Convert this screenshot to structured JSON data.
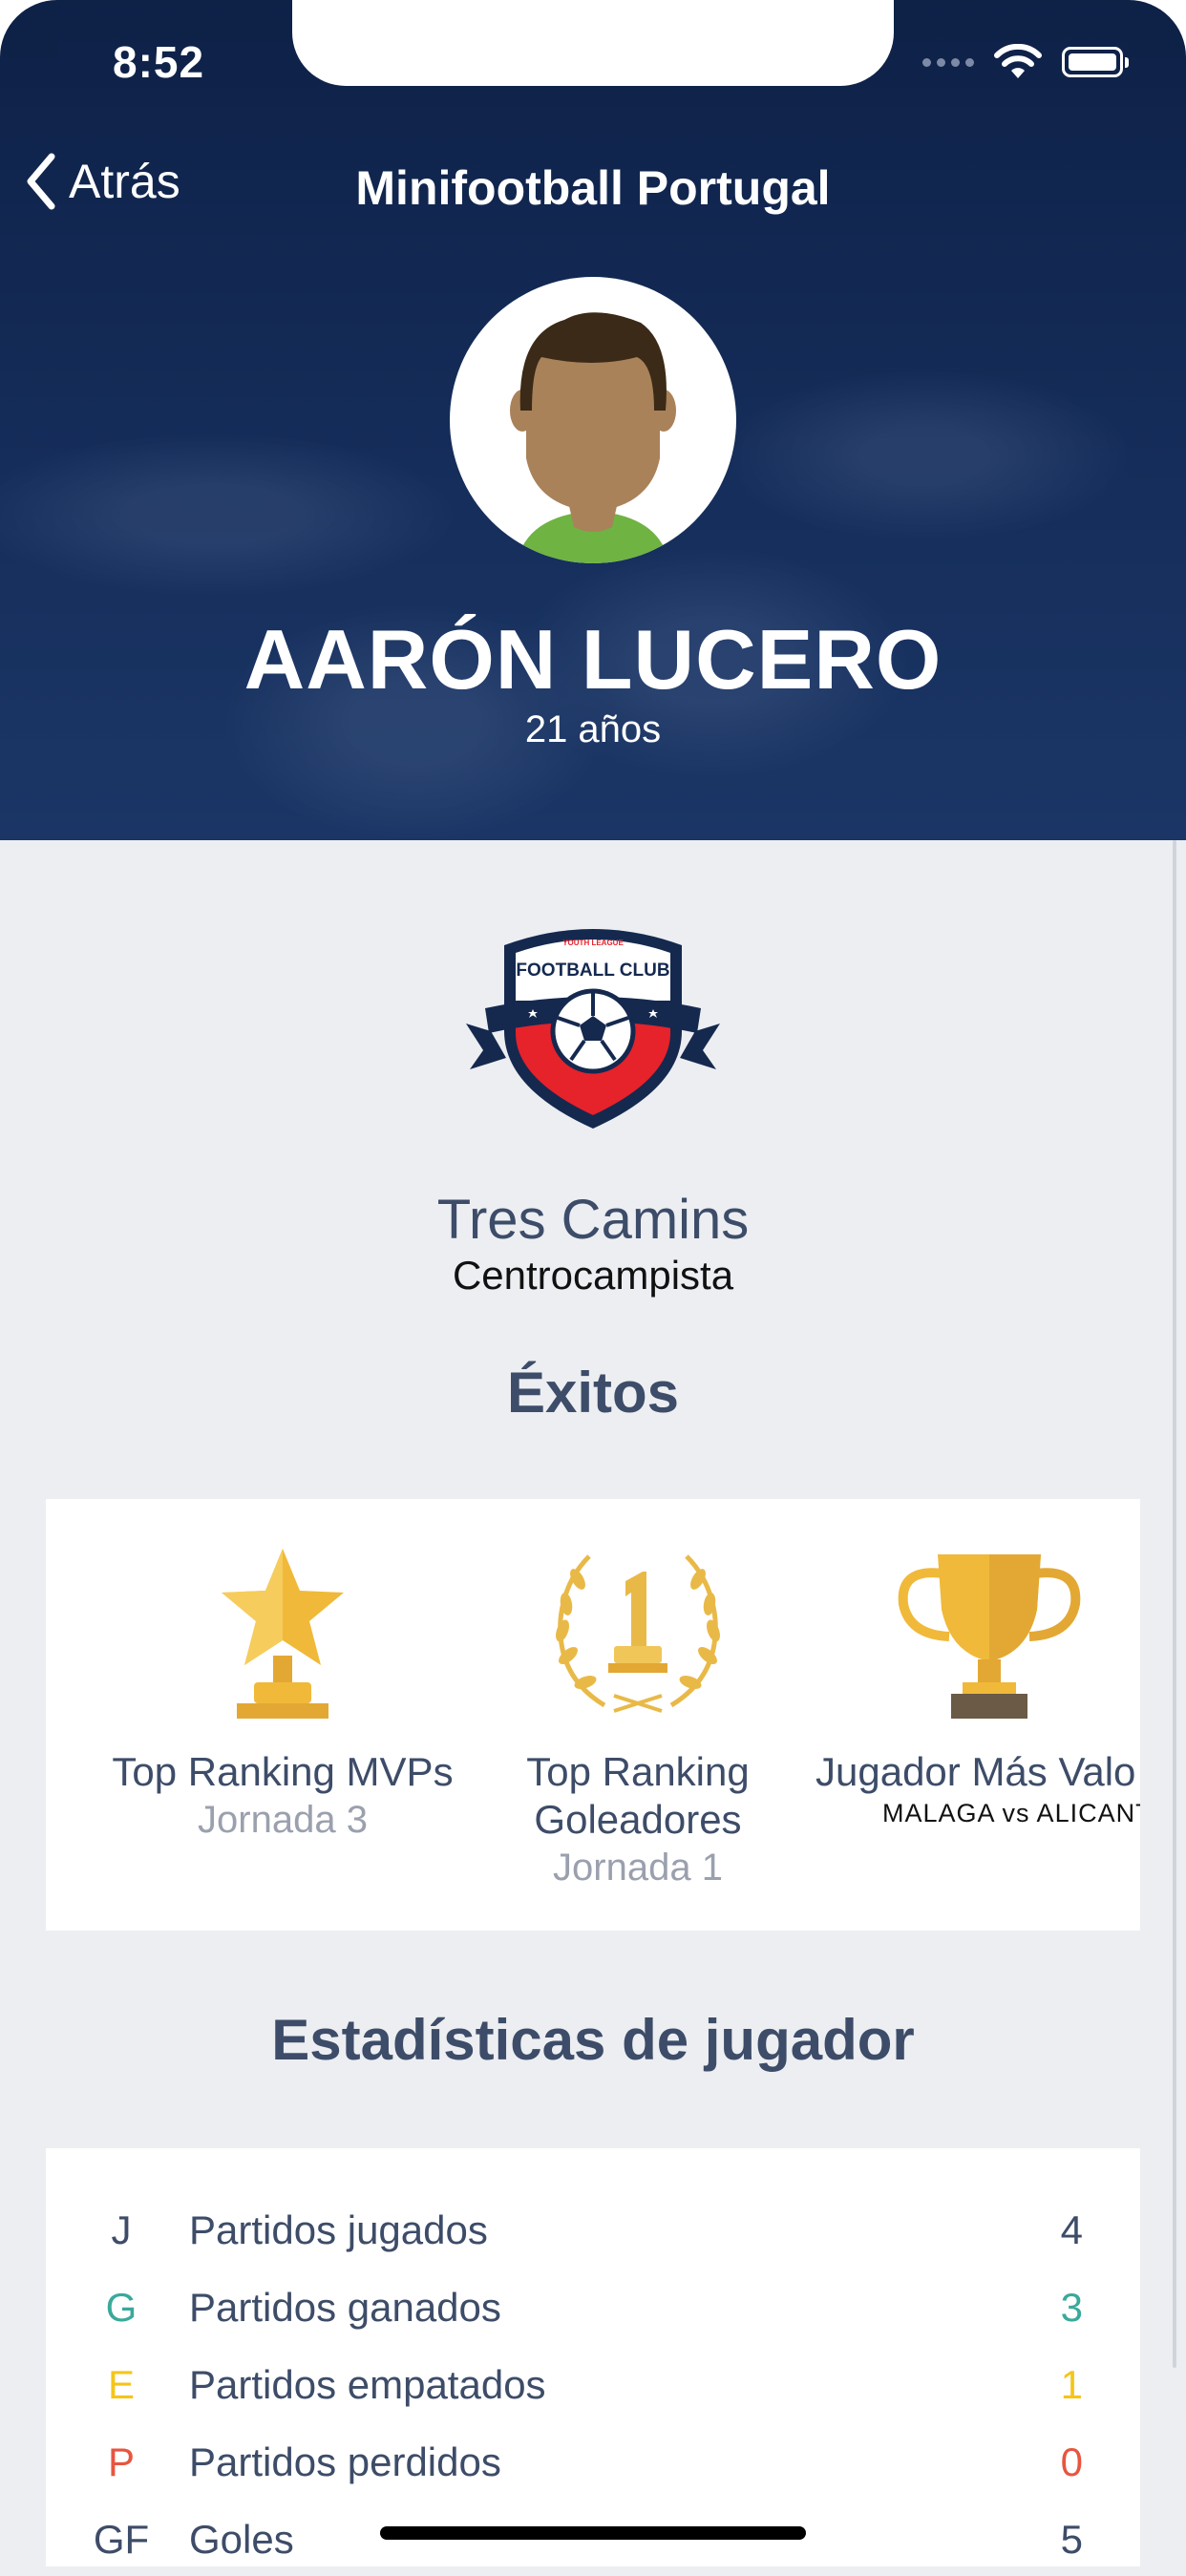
{
  "status_bar": {
    "time": "8:52"
  },
  "nav": {
    "back_label": "Atrás",
    "title": "Minifootball Portugal"
  },
  "player": {
    "name": "AARÓN LUCERO",
    "age": "21 años"
  },
  "team": {
    "crest_top_text": "YOUTH LEAGUE",
    "crest_text": "FOOTBALL CLUB",
    "name": "Tres Camins",
    "position": "Centrocampista"
  },
  "achievements": {
    "title": "Éxitos",
    "items": [
      {
        "icon": "star-trophy-icon",
        "label": "Top Ranking MVPs",
        "sub": "Jornada 3"
      },
      {
        "icon": "laurel-number-one-icon",
        "label": "Top Ranking Goleadores",
        "label_line1": "Top Ranking",
        "label_line2": "Goleadores",
        "sub": "Jornada 1"
      },
      {
        "icon": "cup-trophy-icon",
        "label": "Jugador Más Valo",
        "match": "MALAGA vs ALICANT"
      }
    ]
  },
  "stats": {
    "title": "Estadísticas de jugador",
    "rows": [
      {
        "code": "J",
        "label": "Partidos jugados",
        "value": "4",
        "color": "#3d4c68"
      },
      {
        "code": "G",
        "label": "Partidos ganados",
        "value": "3",
        "color": "#3aa99b"
      },
      {
        "code": "E",
        "label": "Partidos empatados",
        "value": "1",
        "color": "#f5c518"
      },
      {
        "code": "P",
        "label": "Partidos perdidos",
        "value": "0",
        "color": "#e8553f"
      },
      {
        "code": "GF",
        "label": "Goles",
        "value": "5",
        "color": "#3d4c68"
      }
    ]
  },
  "colors": {
    "header_bg": "#0e2147",
    "text_primary": "#3d4c68",
    "muted": "#9aa0ad",
    "page_bg": "#eceef2"
  }
}
